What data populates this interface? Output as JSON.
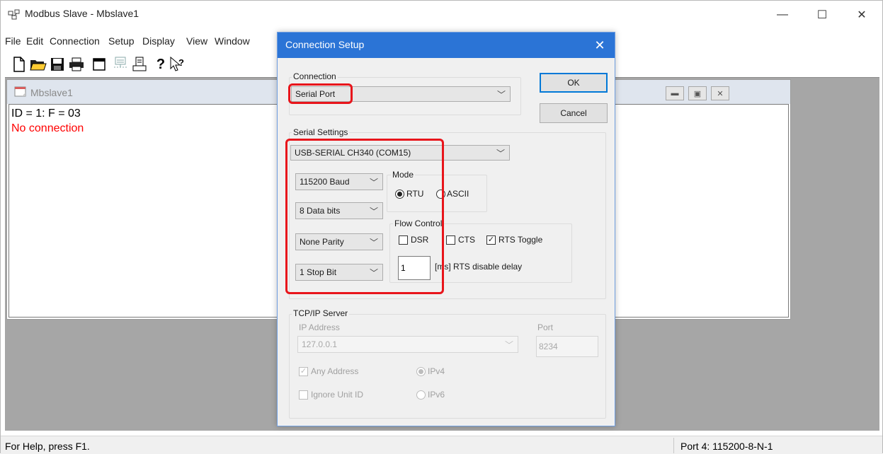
{
  "app": {
    "title": "Modbus Slave - Mbslave1",
    "window_controls": {
      "minimize": "—",
      "maximize": "☐",
      "close": "✕"
    }
  },
  "menu": [
    "File",
    "Edit",
    "Connection",
    "Setup",
    "Display",
    "View",
    "Window"
  ],
  "toolbar_icons": [
    "new-document-icon",
    "open-folder-icon",
    "save-icon",
    "print-icon",
    "window-icon",
    "display-icon",
    "printer-icon",
    "help-icon",
    "context-help-icon"
  ],
  "child": {
    "title": "Mbslave1",
    "line1": "ID = 1: F = 03",
    "line2": "No connection"
  },
  "statusbar": {
    "left": "For Help, press F1.",
    "right": "Port 4: 115200-8-N-1"
  },
  "dialog": {
    "title": "Connection Setup",
    "close": "✕",
    "ok_label": "OK",
    "cancel_label": "Cancel",
    "connection": {
      "label": "Connection",
      "value": "Serial Port"
    },
    "serial": {
      "label": "Serial Settings",
      "port": "USB-SERIAL CH340 (COM15)",
      "baud": "115200 Baud",
      "data_bits": "8 Data bits",
      "parity": "None Parity",
      "stop_bits": "1 Stop Bit",
      "mode": {
        "label": "Mode",
        "rtu": "RTU",
        "ascii": "ASCII",
        "selected": "RTU"
      },
      "flow": {
        "label": "Flow Control",
        "dsr": "DSR",
        "dsr_checked": false,
        "cts": "CTS",
        "cts_checked": false,
        "rts_toggle": "RTS Toggle",
        "rts_checked": true,
        "delay_value": "1",
        "delay_label": "[ms] RTS disable delay"
      }
    },
    "tcp": {
      "label": "TCP/IP Server",
      "ip_label": "IP Address",
      "ip_value": "127.0.0.1",
      "port_label": "Port",
      "port_value": "8234",
      "any_address": "Any Address",
      "any_checked": true,
      "ignore_unit": "Ignore Unit ID",
      "ignore_checked": false,
      "ipv4": "IPv4",
      "ipv6": "IPv6",
      "ip_version": "IPv4"
    }
  },
  "highlight_color": "#e8151b"
}
